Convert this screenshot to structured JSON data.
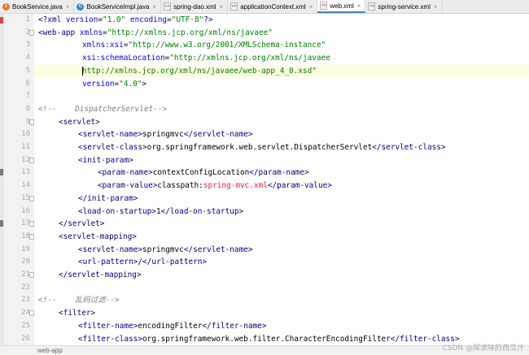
{
  "tabs": [
    {
      "label": "BookService.java",
      "icon": "java-class-icon"
    },
    {
      "label": "BookServiceImpl.java",
      "icon": "java-class-icon"
    },
    {
      "label": "spring-dao.xml",
      "icon": "xml-file-icon"
    },
    {
      "label": "applicationContext.xml",
      "icon": "xml-file-icon"
    },
    {
      "label": "web.xml",
      "icon": "xml-file-icon",
      "active": true
    },
    {
      "label": "spring-service.xml",
      "icon": "xml-file-icon"
    }
  ],
  "line_numbers": [
    "1",
    "2",
    "3",
    "4",
    "5",
    "6",
    "7",
    "8",
    "9",
    "10",
    "11",
    "12",
    "13",
    "14",
    "15",
    "16",
    "17",
    "18",
    "19",
    "20",
    "21",
    "22",
    "23",
    "24",
    "25",
    "26"
  ],
  "code": {
    "l1": {
      "open": "<?",
      "xml": "xml",
      "attr1": " version",
      "eq1": "=",
      "v1": "\"1.0\"",
      "attr2": " encoding",
      "eq2": "=",
      "v2": "\"UTF-8\"",
      "close": "?>"
    },
    "l2": {
      "open": "<web-app",
      "attr": " xmlns",
      "eq": "=",
      "val": "\"http://xmlns.jcp.org/xml/ns/javaee\""
    },
    "l3": {
      "attr": "xmlns:xsi",
      "eq": "=",
      "val": "\"http://www.w3.org/2001/XMLSchema-instance\""
    },
    "l4": {
      "attr": "xsi:schemaLocation",
      "eq": "=",
      "val": "\"http://xmlns.jcp.org/xml/ns/javaee"
    },
    "l5": {
      "val": "http://xmlns.jcp.org/xml/ns/javaee/web-app_4_0.xsd\""
    },
    "l6": {
      "attr": "version",
      "eq": "=",
      "val": "\"4.0\"",
      "close": ">"
    },
    "l8": {
      "comment": "<!--    DispatcherServlet-->"
    },
    "l9": {
      "tag": "<servlet>"
    },
    "l10": {
      "o": "<servlet-name>",
      "t": "springmvc",
      "c": "</servlet-name>"
    },
    "l11": {
      "o": "<servlet-class>",
      "t": "org.springframework.web.servlet.DispatcherServlet",
      "c": "</servlet-class>"
    },
    "l12": {
      "tag": "<init-param>"
    },
    "l13": {
      "o": "<param-name>",
      "t": "contextConfigLocation",
      "c": "</param-name>"
    },
    "l14": {
      "o": "<param-value>",
      "t": "classpath:",
      "r": "spring-mvc.xml",
      "c": "</param-value>"
    },
    "l15": {
      "tag": "</init-param>"
    },
    "l16": {
      "o": "<load-on-startup>",
      "t": "1",
      "c": "</load-on-startup>"
    },
    "l17": {
      "tag": "</servlet>"
    },
    "l18": {
      "tag": "<servlet-mapping>"
    },
    "l19": {
      "o": "<servlet-name>",
      "t": "springmvc",
      "c": "</servlet-name>"
    },
    "l20": {
      "o": "<url-pattern>",
      "t": "/",
      "c": "</url-pattern>"
    },
    "l21": {
      "tag": "</servlet-mapping>"
    },
    "l23": {
      "comment": "<!--    乱码过滤-->"
    },
    "l24": {
      "tag": "<filter>"
    },
    "l25": {
      "o": "<filter-name>",
      "t": "encodingFilter",
      "c": "</filter-name>"
    },
    "l26": {
      "o": "<filter-class>",
      "t": "org.springframework.web.filter.CharacterEncodingFilter",
      "c": "</filter-class>"
    }
  },
  "status": {
    "breadcrumb": "web-app"
  },
  "watermark": "CSDN @探求味的西瓜汁"
}
